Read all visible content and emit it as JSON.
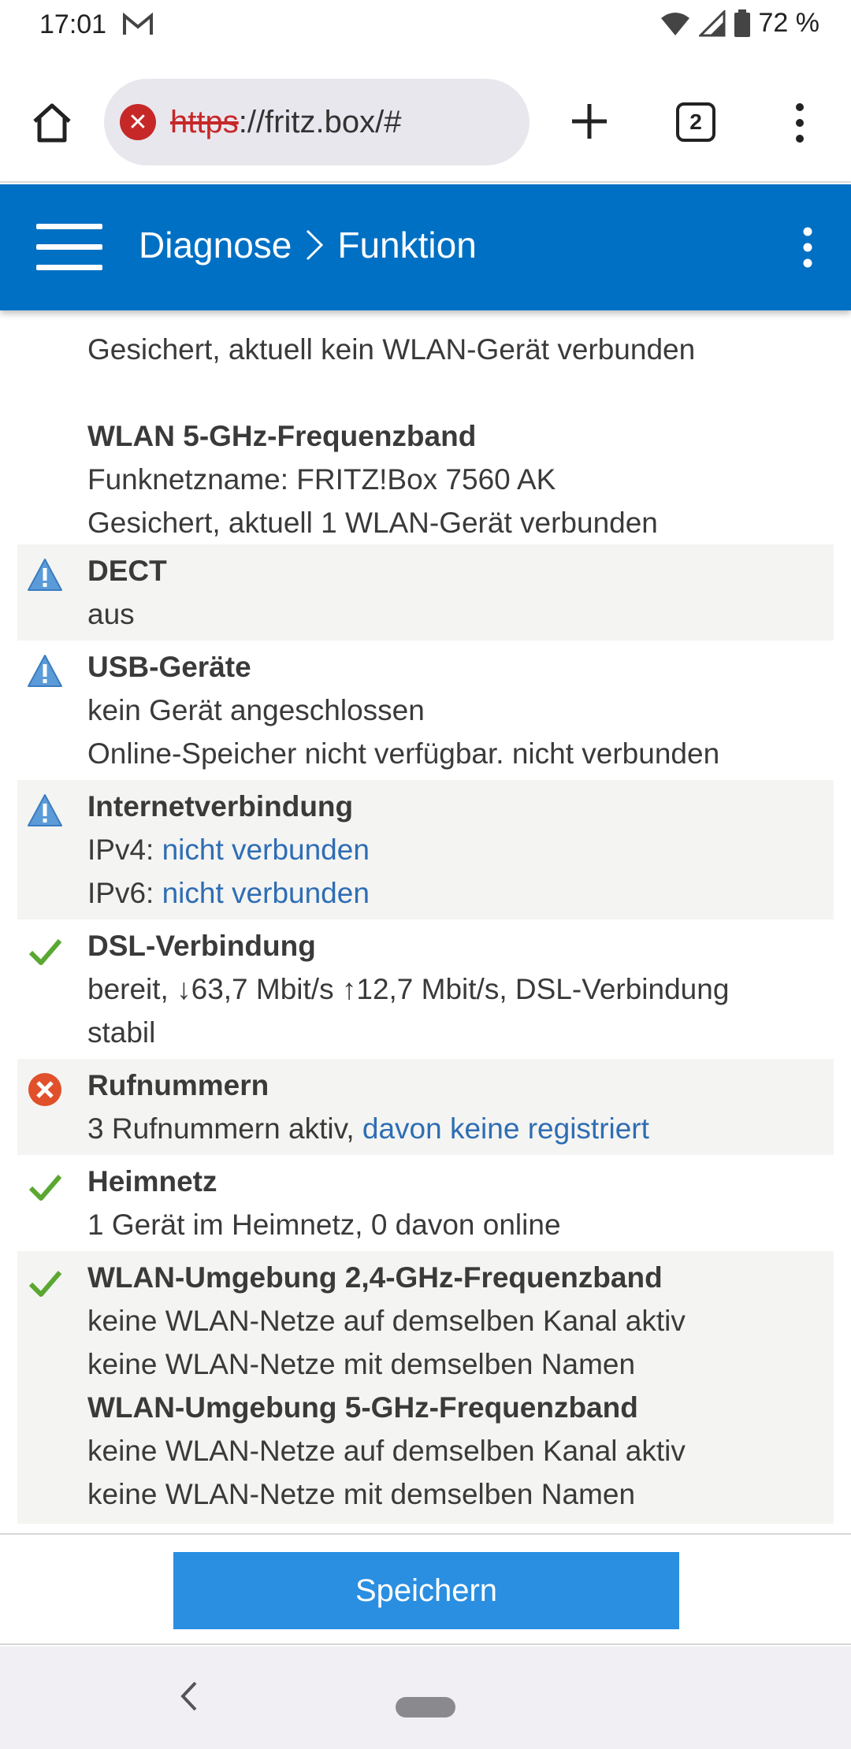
{
  "status_bar": {
    "time": "17:01",
    "battery": "72 %"
  },
  "browser": {
    "url_scheme": "https",
    "url_rest": "://fritz.box/#",
    "tab_count": "2"
  },
  "header": {
    "crumb_1": "Diagnose",
    "crumb_sep": ">",
    "crumb_2": "Funktion"
  },
  "content": {
    "wlan24_status": "Gesichert, aktuell kein WLAN-Gerät verbunden",
    "wlan5_title": "WLAN 5-GHz-Frequenzband",
    "wlan5_name": "Funknetzname: FRITZ!Box 7560 AK",
    "wlan5_status": "Gesichert, aktuell 1 WLAN-Gerät verbunden",
    "dect_title": "DECT",
    "dect_status": "aus",
    "usb_title": "USB-Geräte",
    "usb_line1": "kein Gerät angeschlossen",
    "usb_line2": "Online-Speicher nicht verfügbar. nicht verbunden",
    "inet_title": "Internetverbindung",
    "inet_ipv4_label": "IPv4: ",
    "inet_ipv4_link": "nicht verbunden",
    "inet_ipv6_label": "IPv6: ",
    "inet_ipv6_link": "nicht verbunden",
    "dsl_title": "DSL-Verbindung",
    "dsl_line1": "bereit, ↓63,7 Mbit/s ↑12,7 Mbit/s, DSL-Verbindung",
    "dsl_line2": "stabil",
    "ruf_title": "Rufnummern",
    "ruf_text": "3 Rufnummern aktiv, ",
    "ruf_link": "davon keine registriert",
    "heim_title": "Heimnetz",
    "heim_text": "1 Gerät im Heimnetz, 0 davon online",
    "env24_title": "WLAN-Umgebung 2,4-GHz-Frequenzband",
    "env24_line1": "keine WLAN-Netze auf demselben Kanal aktiv",
    "env24_line2": "keine WLAN-Netze mit demselben Namen",
    "env5_title": "WLAN-Umgebung 5-GHz-Frequenzband",
    "env5_line1": "keine WLAN-Netze auf demselben Kanal aktiv",
    "env5_line2": "keine WLAN-Netze mit demselben Namen"
  },
  "footer": {
    "save_label": "Speichern"
  },
  "colors": {
    "header": "#0070c4",
    "button": "#2a8fe1",
    "link": "#2e6db4",
    "ok": "#5aa832",
    "error": "#e0502a",
    "warn": "#4a90d0"
  },
  "icons": {
    "warning": "warning-triangle-icon",
    "ok": "checkmark-icon",
    "error": "error-x-icon"
  }
}
